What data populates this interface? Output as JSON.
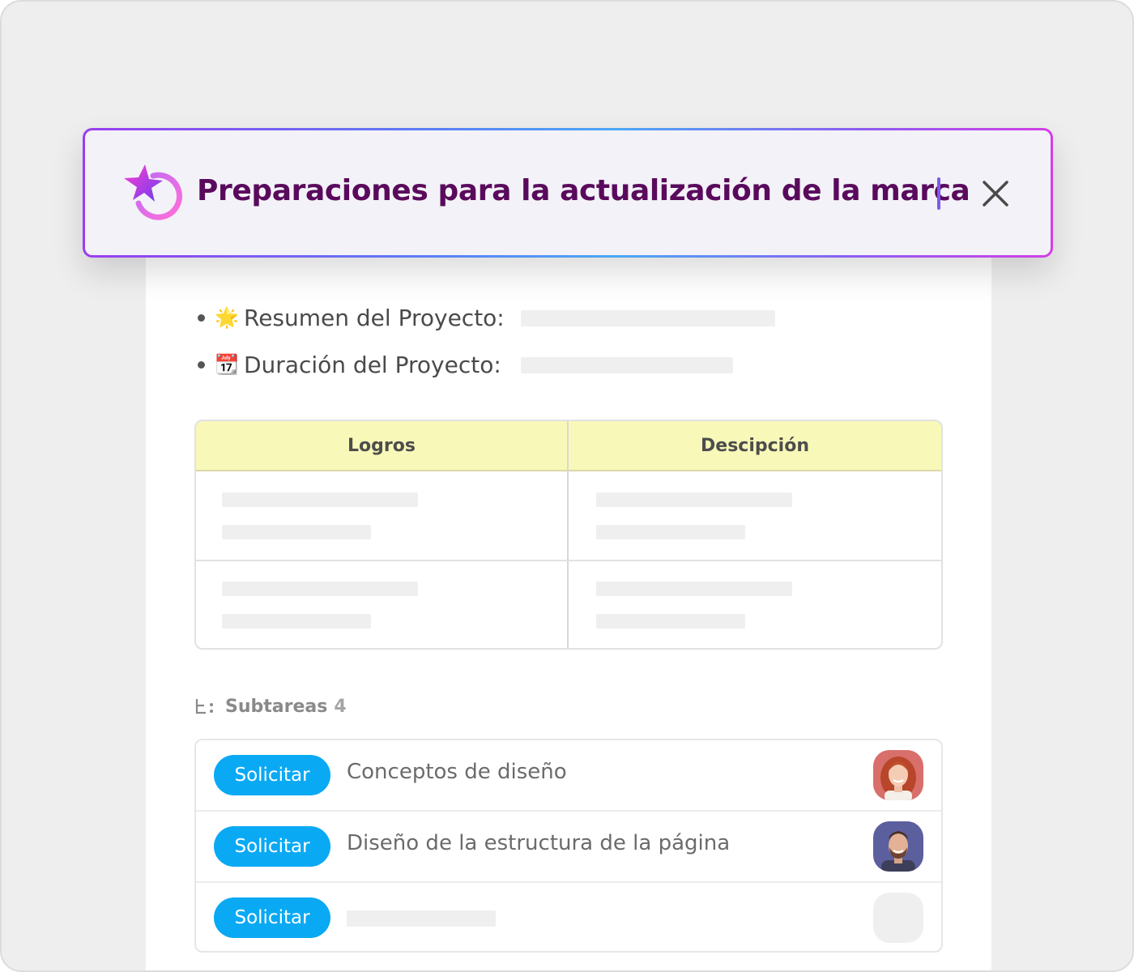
{
  "title_bar": {
    "title": "Preparaciones para la actualización de la marca",
    "close_icon": "close-icon",
    "logo_icon": "sparkle-loop-icon"
  },
  "fields": [
    {
      "emoji": "🌟",
      "label": "Resumen del Proyecto:"
    },
    {
      "emoji": "📆",
      "label": "Duración del Proyecto:"
    }
  ],
  "table": {
    "headers": [
      "Logros",
      "Descipción"
    ],
    "header_color": "#f8f9b8"
  },
  "subtasks": {
    "label": "Subtareas",
    "count": "4",
    "items": [
      {
        "button": "Solicitar",
        "text": "Conceptos de diseño",
        "avatar": "woman-redhead-avatar"
      },
      {
        "button": "Solicitar",
        "text": "Diseño de la estructura de la página",
        "avatar": "man-bearded-avatar"
      },
      {
        "button": "Solicitar",
        "text": "",
        "avatar": "empty-avatar"
      }
    ]
  },
  "colors": {
    "accent_button": "#0aa9f4",
    "title_text": "#5a0a5c"
  }
}
